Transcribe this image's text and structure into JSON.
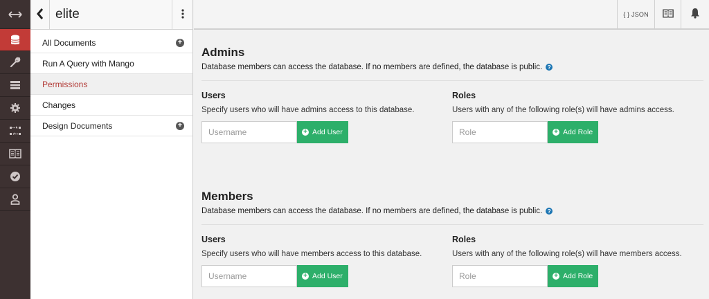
{
  "rail": {
    "items": [
      {
        "icon": "arrows-horizontal-icon"
      },
      {
        "icon": "database-icon",
        "active": true
      },
      {
        "icon": "wrench-icon"
      },
      {
        "icon": "server-icon"
      },
      {
        "icon": "gear-icon"
      },
      {
        "icon": "replication-icon"
      },
      {
        "icon": "book-icon"
      },
      {
        "icon": "check-circle-icon"
      },
      {
        "icon": "user-icon"
      }
    ],
    "accent": "#c23b37",
    "background": "#3d3131"
  },
  "sidebar": {
    "title": "elite",
    "items": [
      {
        "label": "All Documents",
        "has_add": true
      },
      {
        "label": "Run A Query with Mango",
        "has_add": false
      },
      {
        "label": "Permissions",
        "has_add": false,
        "active": true
      },
      {
        "label": "Changes",
        "has_add": false
      },
      {
        "label": "Design Documents",
        "has_add": true
      }
    ]
  },
  "topbar": {
    "json_label": "{ } JSON"
  },
  "admins": {
    "title": "Admins",
    "desc": "Database members can access the database. If no members are defined, the database is public.",
    "users": {
      "title": "Users",
      "desc": "Specify users who will have admins access to this database.",
      "placeholder": "Username",
      "button": "Add User"
    },
    "roles": {
      "title": "Roles",
      "desc": "Users with any of the following role(s) will have admins access.",
      "placeholder": "Role",
      "button": "Add Role"
    }
  },
  "members": {
    "title": "Members",
    "desc": "Database members can access the database. If no members are defined, the database is public.",
    "users": {
      "title": "Users",
      "desc": "Specify users who will have members access to this database.",
      "placeholder": "Username",
      "button": "Add User"
    },
    "roles": {
      "title": "Roles",
      "desc": "Users with any of the following role(s) will have members access.",
      "placeholder": "Role",
      "button": "Add Role"
    }
  },
  "colors": {
    "add_button": "#2daf6a",
    "active_link": "#b23a36",
    "help_icon": "#1f77b4"
  }
}
